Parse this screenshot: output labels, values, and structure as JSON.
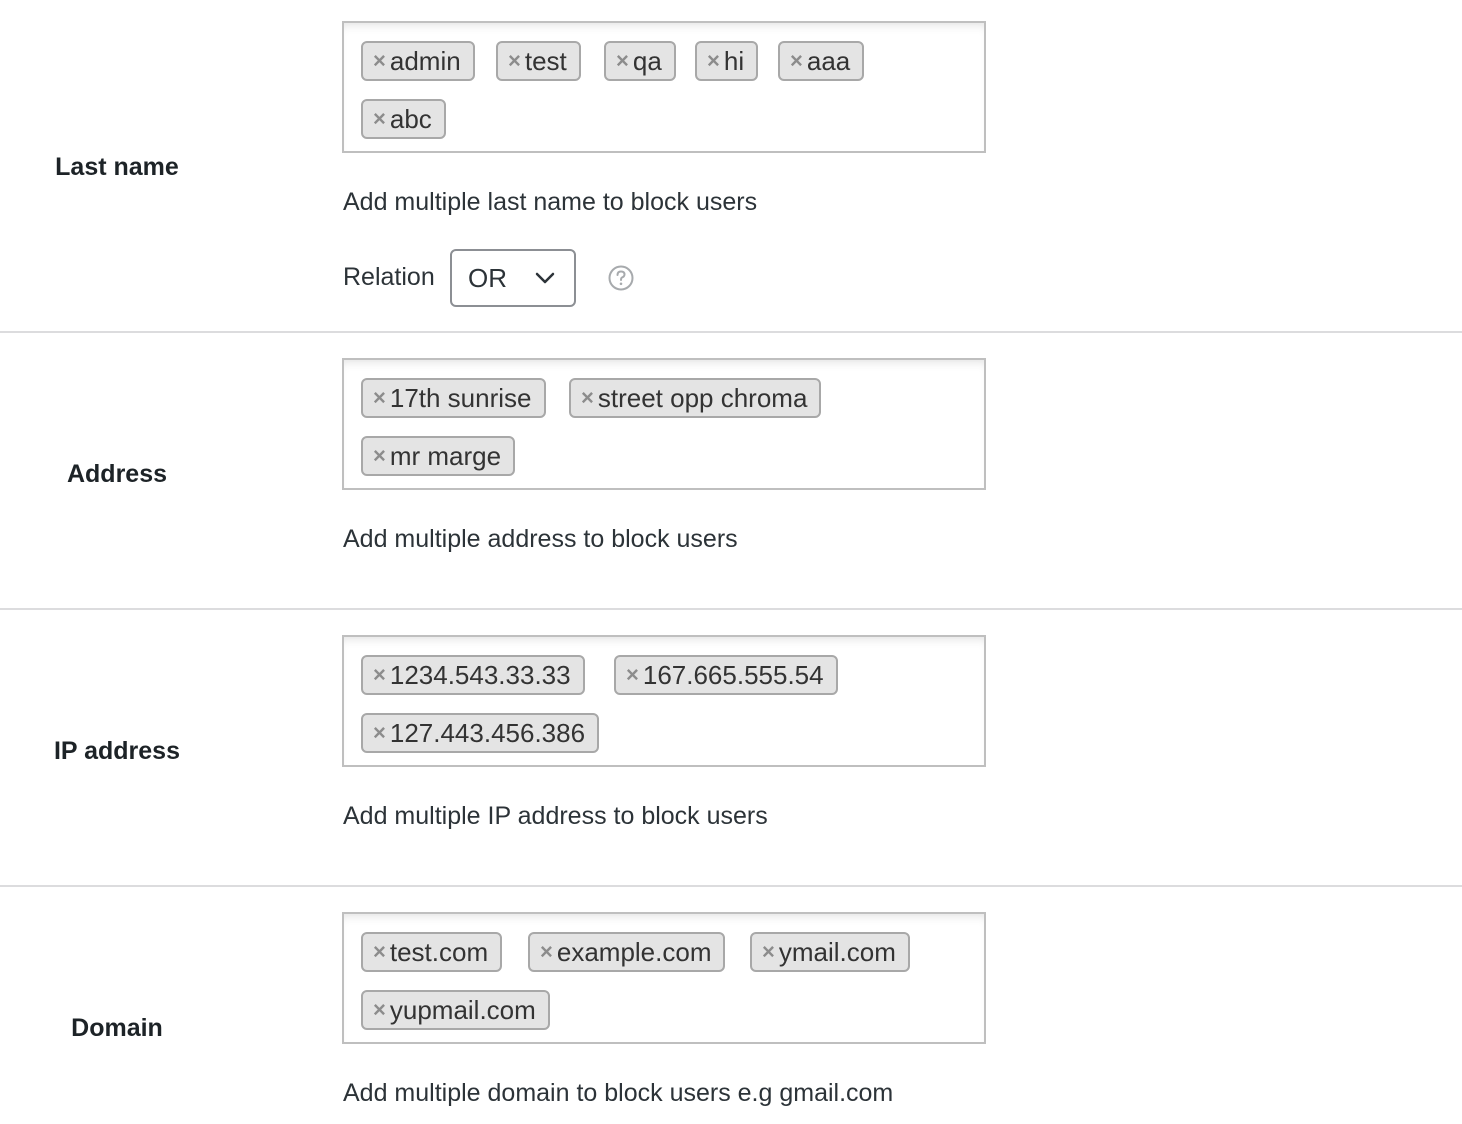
{
  "sections": {
    "last_name": {
      "label": "Last name",
      "tags": [
        "admin",
        "test",
        "qa",
        "hi",
        "aaa",
        "abc"
      ],
      "description": "Add multiple last name to block users",
      "relation_label": "Relation",
      "relation_value": "OR"
    },
    "address": {
      "label": "Address",
      "tags": [
        "17th sunrise",
        "street opp chroma",
        "mr marge"
      ],
      "description": "Add multiple address to block users"
    },
    "ip_address": {
      "label": "IP address",
      "tags": [
        "1234.543.33.33",
        "167.665.555.54",
        "127.443.456.386"
      ],
      "description": "Add multiple IP address to block users"
    },
    "domain": {
      "label": "Domain",
      "tags": [
        "test.com",
        "example.com",
        "ymail.com",
        "yupmail.com"
      ],
      "description": "Add multiple domain to block users e.g gmail.com"
    }
  },
  "icons": {
    "remove": "close-icon",
    "dropdown": "chevron-down-icon",
    "help": "question-circle-icon"
  },
  "colors": {
    "tag_bg": "#e4e4e4",
    "tag_border": "#a8a8a8",
    "divider": "#dcdcde",
    "text": "#1d2327"
  }
}
